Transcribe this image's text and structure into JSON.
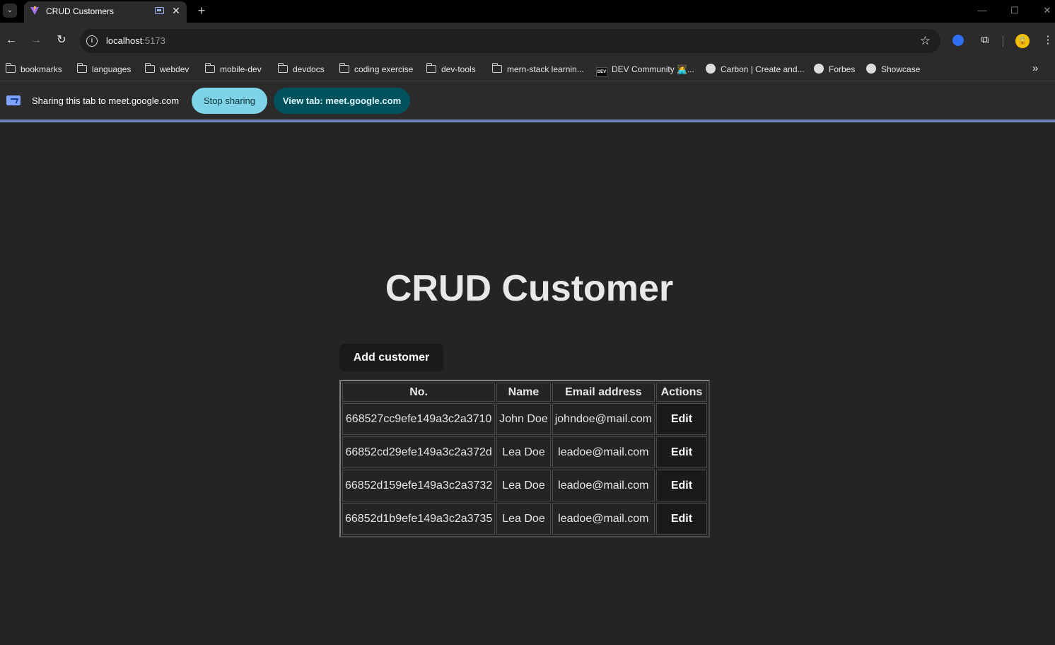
{
  "browser": {
    "tab_title": "CRUD Customers",
    "new_tab_symbol": "+",
    "url_host": "localhost",
    "url_port": ":5173",
    "bookmarks": [
      {
        "label": "bookmarks",
        "icon": "folder-icon"
      },
      {
        "label": "languages",
        "icon": "folder-icon"
      },
      {
        "label": "webdev",
        "icon": "folder-icon"
      },
      {
        "label": "mobile-dev",
        "icon": "folder-icon"
      },
      {
        "label": "devdocs",
        "icon": "folder-icon"
      },
      {
        "label": "coding exercise",
        "icon": "folder-icon"
      },
      {
        "label": "dev-tools",
        "icon": "folder-icon"
      },
      {
        "label": "mern-stack learnin...",
        "icon": "folder-icon"
      },
      {
        "label": "DEV Community 👩‍💻...",
        "icon": "dev-icon"
      },
      {
        "label": "Carbon | Create and...",
        "icon": "globe-icon"
      },
      {
        "label": "Forbes",
        "icon": "globe-icon"
      },
      {
        "label": "Showcase",
        "icon": "globe-icon"
      }
    ]
  },
  "sharing": {
    "text": "Sharing this tab to meet.google.com",
    "stop_label": "Stop sharing",
    "view_label": "View tab: meet.google.com"
  },
  "page": {
    "title": "CRUD Customer",
    "add_button": "Add customer",
    "table": {
      "headers": [
        "No.",
        "Name",
        "Email address",
        "Actions"
      ],
      "rows": [
        {
          "id": "668527cc9efe149a3c2a3710",
          "name": "John Doe",
          "email": "johndoe@mail.com",
          "action": "Edit"
        },
        {
          "id": "66852cd29efe149a3c2a372d",
          "name": "Lea Doe",
          "email": "leadoe@mail.com",
          "action": "Edit"
        },
        {
          "id": "66852d159efe149a3c2a3732",
          "name": "Lea Doe",
          "email": "leadoe@mail.com",
          "action": "Edit"
        },
        {
          "id": "66852d1b9efe149a3c2a3735",
          "name": "Lea Doe",
          "email": "leadoe@mail.com",
          "action": "Edit"
        }
      ]
    }
  },
  "colors": {
    "page_bg": "#242424",
    "browser_chrome": "#2b2b2b",
    "stop_sharing_bg": "#7ed3e6",
    "view_tab_bg": "#00525e",
    "button_bg": "#1a1a1a"
  }
}
